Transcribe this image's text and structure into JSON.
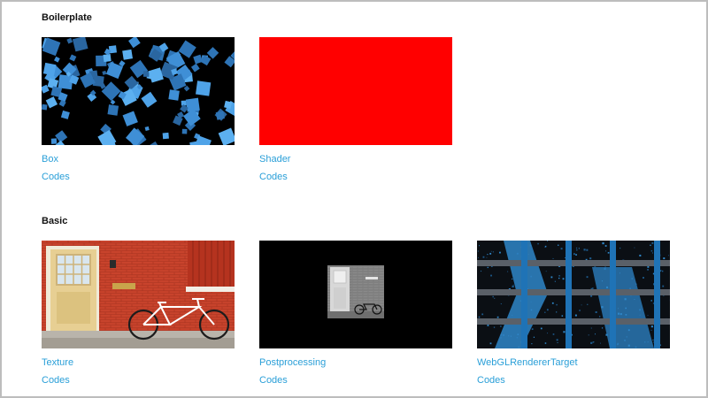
{
  "sections": [
    {
      "title": "Boilerplate",
      "items": [
        {
          "title": "Box",
          "codes": "Codes",
          "thumb": "rotating-blue-cubes"
        },
        {
          "title": "Shader",
          "codes": "Codes",
          "thumb": "solid-red"
        }
      ]
    },
    {
      "title": "Basic",
      "items": [
        {
          "title": "Texture",
          "codes": "Codes",
          "thumb": "red-brick-door-bicycle"
        },
        {
          "title": "Postprocessing",
          "codes": "Codes",
          "thumb": "grayscale-door-bicycle"
        },
        {
          "title": "WebGLRendererTarget",
          "codes": "Codes",
          "thumb": "blue-grid-render-target"
        }
      ]
    }
  ],
  "colors": {
    "link": "#2a9fd8",
    "cube_blue": "#3f8fd6",
    "shader_red": "#ff0000",
    "brick": "#c8412b"
  }
}
